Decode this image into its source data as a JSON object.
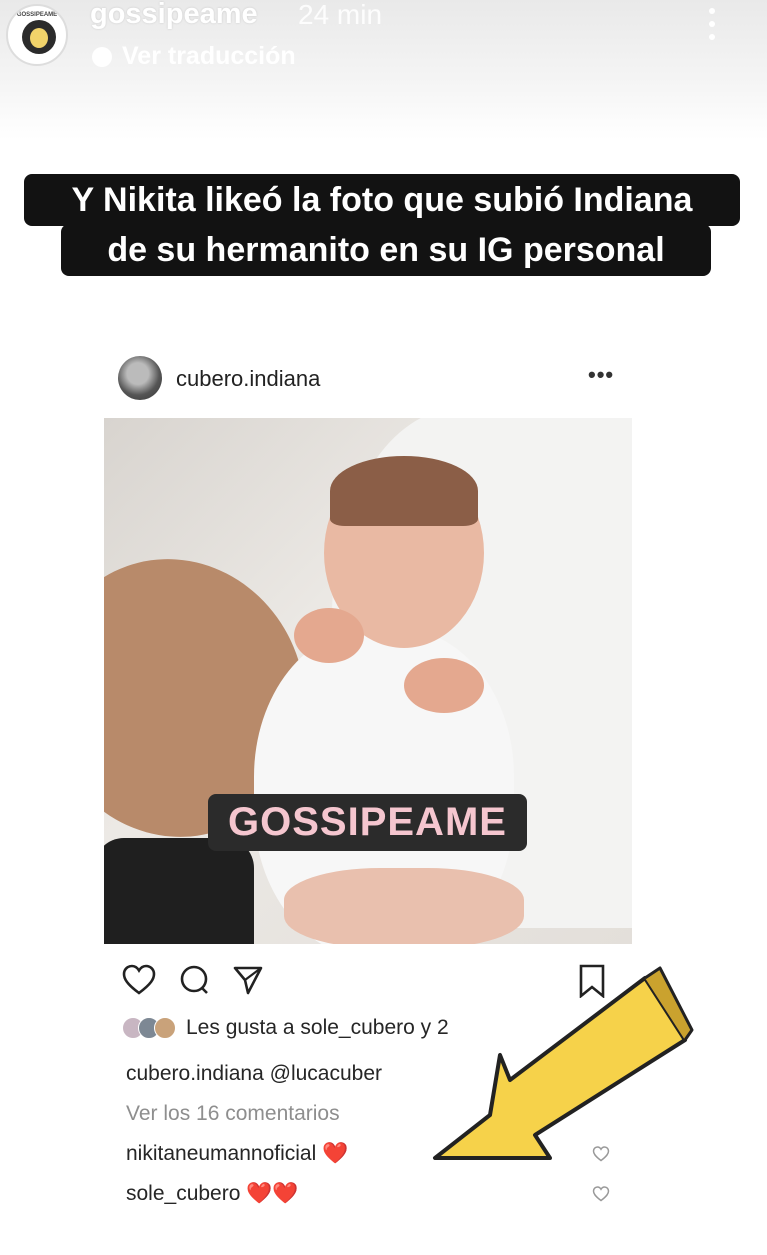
{
  "story": {
    "account": "gossipeame",
    "avatar_caption": "GOSSIPEAME",
    "time": "24 min",
    "translate": "Ver traducción",
    "caption_lines": [
      "Y Nikita likeó la foto que subió Indiana",
      "de su hermanito en su IG personal"
    ]
  },
  "post": {
    "user": "cubero.indiana",
    "more": "•••",
    "watermark": "GOSSIPEAME",
    "likes_text": "Les gusta a sole_cubero y 2",
    "caption_user": "cubero.indiana",
    "caption_mention": "@lucacuber",
    "comments_link": "Ver los 16 comentarios",
    "comments": [
      {
        "user": "nikitaneumannoficial",
        "text": "❤️"
      },
      {
        "user": "sole_cubero",
        "text": "❤️❤️"
      }
    ]
  },
  "colors": {
    "caption_bg": "#121212",
    "watermark_text": "#f5c6cf",
    "arrow": "#f6d24a",
    "heart": "#e5302f"
  }
}
